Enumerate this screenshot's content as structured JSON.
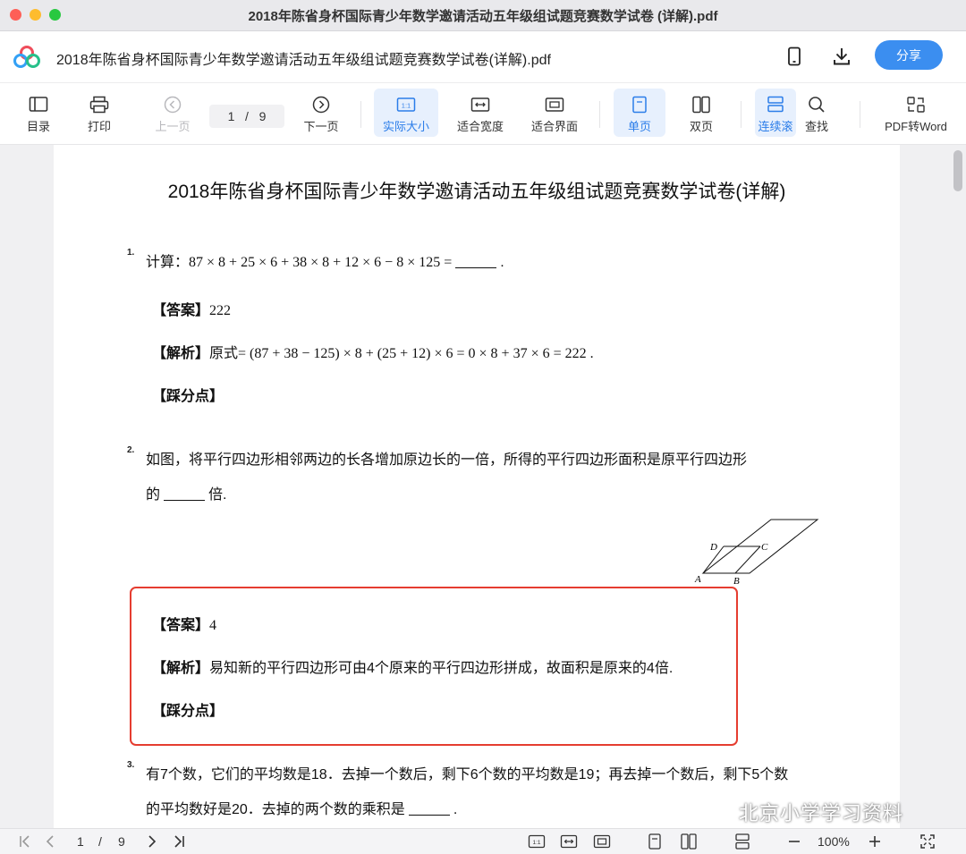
{
  "window": {
    "title": "2018年陈省身杯国际青少年数学邀请活动五年级组试题竞赛数学试卷 (详解).pdf"
  },
  "appbar": {
    "doc_title": "2018年陈省身杯国际青少年数学邀请活动五年级组试题竞赛数学试卷(详解).pdf",
    "share_label": "分享"
  },
  "toolbar": {
    "toc": "目录",
    "print": "打印",
    "prev": "上一页",
    "page_current": "1",
    "page_sep": "/",
    "page_total": "9",
    "next": "下一页",
    "actual_size": "实际大小",
    "fit_width": "适合宽度",
    "fit_page": "适合界面",
    "single": "单页",
    "double": "双页",
    "continuous": "连续滚",
    "search": "查找",
    "pdf2word": "PDF转Word"
  },
  "page": {
    "title": "2018年陈省身杯国际青少年数学邀请活动五年级组试题竞赛数学试卷(详解)",
    "q1": {
      "num": "1.",
      "prefix": "计算：",
      "expr": "87 × 8 + 25 × 6 + 38 × 8 + 12 × 6 − 8 × 125 =",
      "end": ".",
      "answer_label": "【答案】",
      "answer": "222",
      "analysis_label": "【解析】",
      "analysis_prefix": "原式",
      "analysis_expr": "= (87 + 38 − 125) × 8 + (25 + 12) × 6 = 0 × 8 + 37 × 6 = 222 .",
      "points_label": "【踩分点】"
    },
    "q2": {
      "num": "2.",
      "line1": "如图，将平行四边形相邻两边的长各增加原边长的一倍，所得的平行四边形面积是原平行四边形",
      "line2_prefix": "的",
      "line2_suffix": "倍.",
      "fig_labels": {
        "a": "A",
        "b": "B",
        "c": "C",
        "d": "D"
      },
      "answer_label": "【答案】",
      "answer": "4",
      "analysis_label": "【解析】",
      "analysis": "易知新的平行四边形可由4个原来的平行四边形拼成，故面积是原来的4倍.",
      "points_label": "【踩分点】"
    },
    "q3": {
      "num": "3.",
      "line1": "有7个数，它们的平均数是18．去掉一个数后，剩下6个数的平均数是19；再去掉一个数后，剩下5个数",
      "line2_prefix": "的平均数好是20．去掉的两个数的乘积是",
      "line2_suffix": "."
    }
  },
  "bottombar": {
    "page_current": "1",
    "page_sep": "/",
    "page_total": "9",
    "zoom": "100%"
  },
  "watermark": "北京小学学习资料",
  "colors": {
    "accent": "#3b8ef0",
    "highlight_border": "#e53d30"
  }
}
